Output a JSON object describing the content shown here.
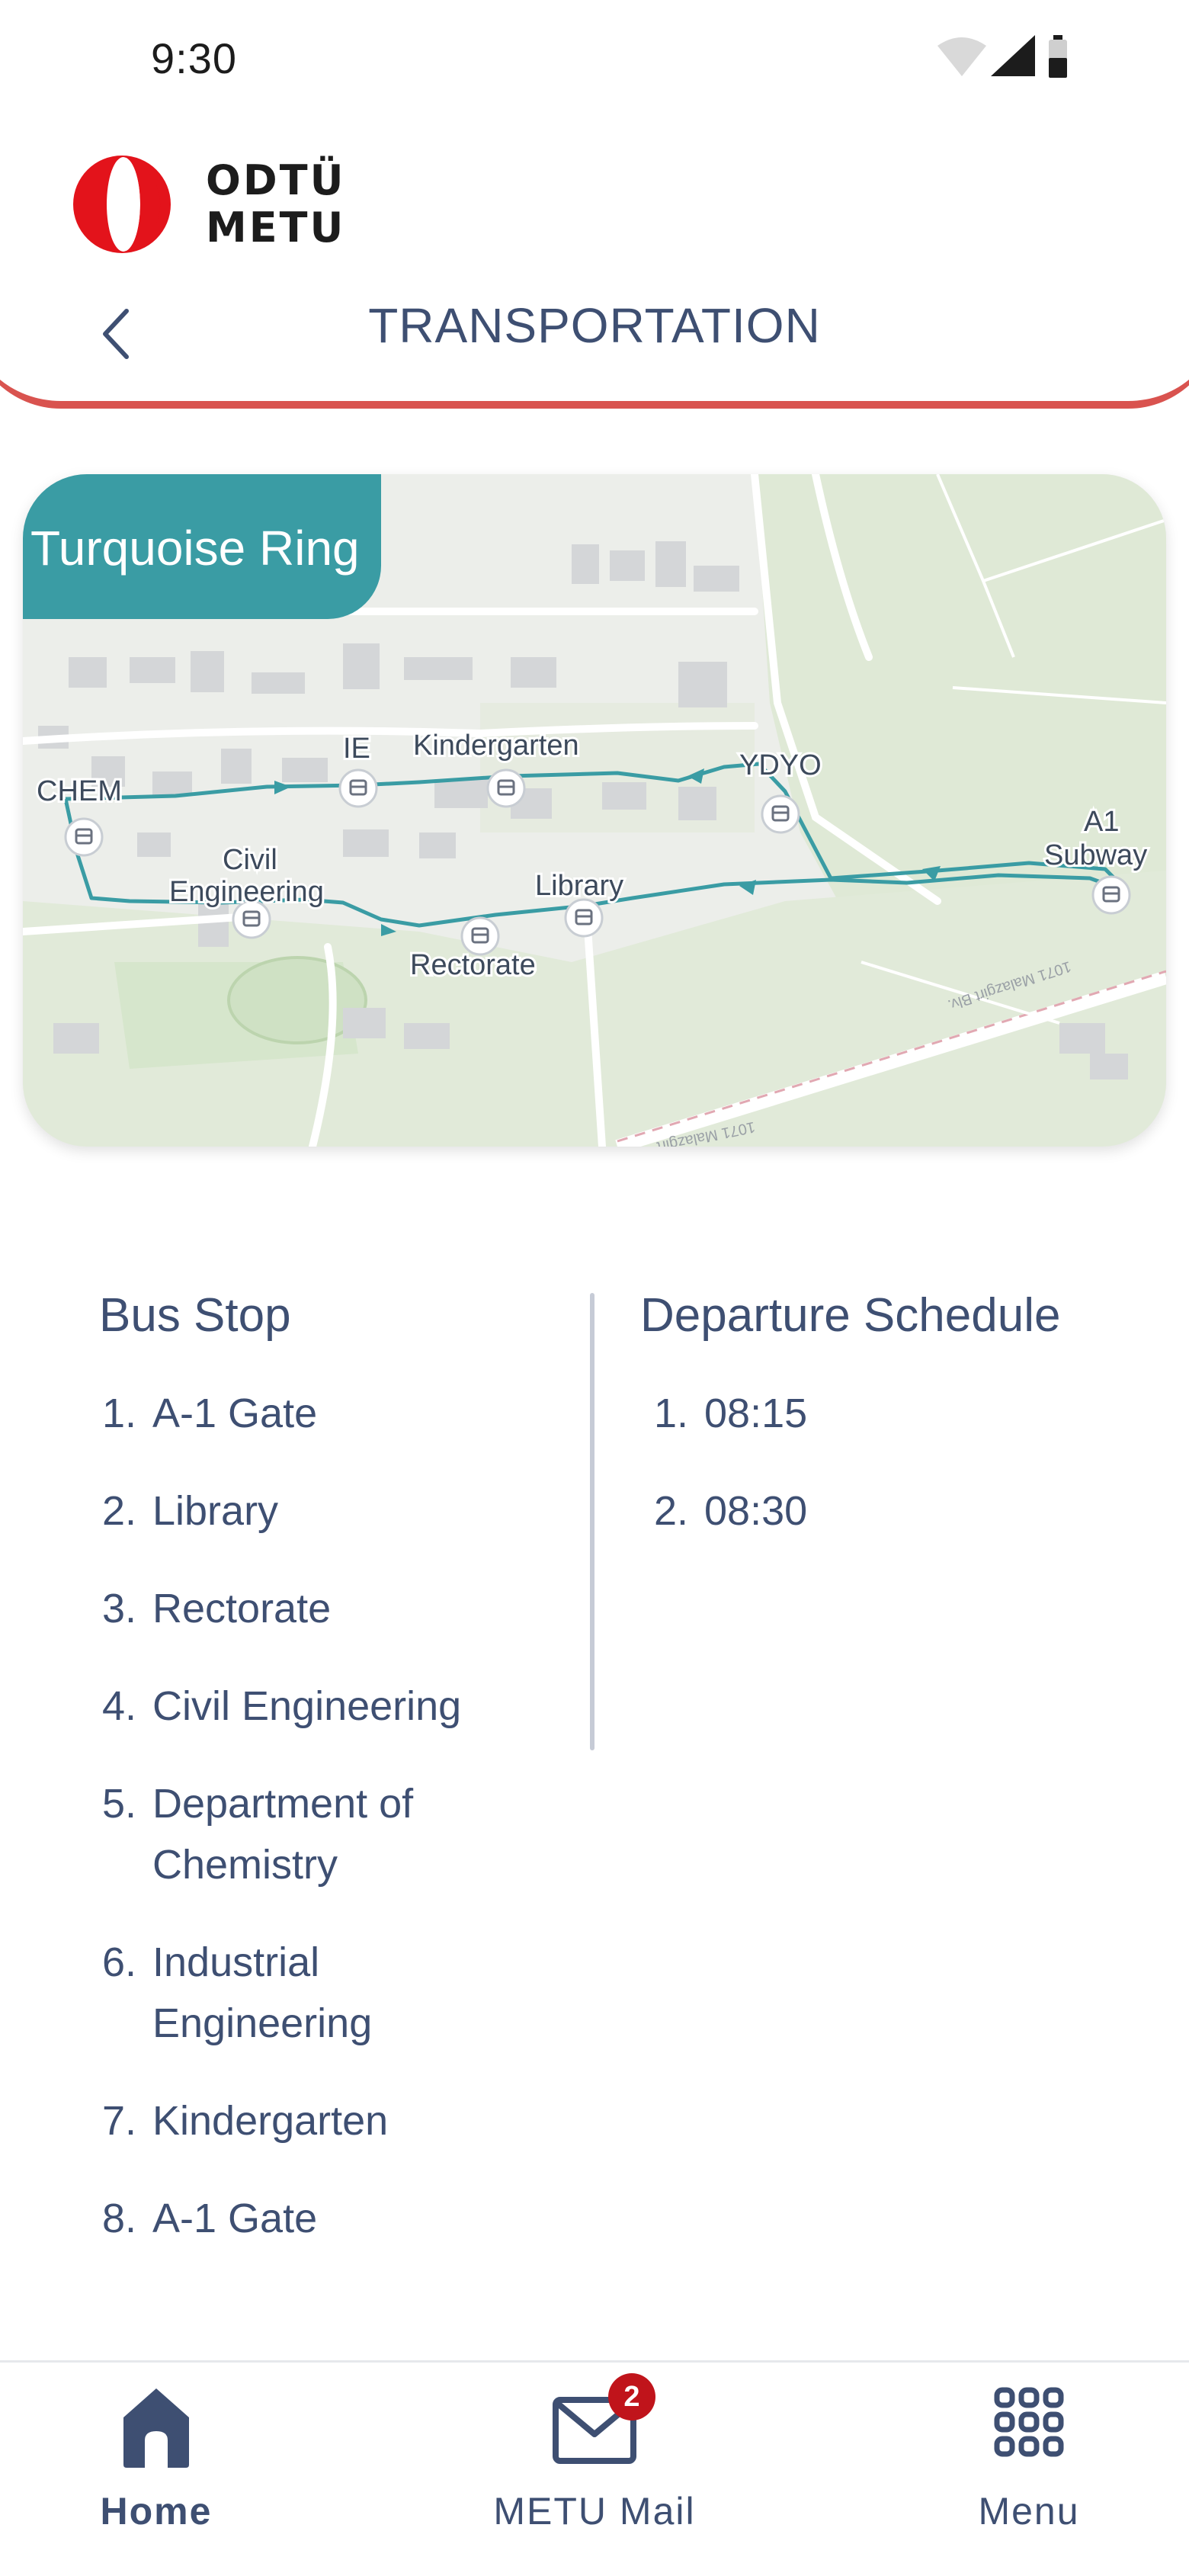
{
  "status_bar": {
    "time": "9:30"
  },
  "brand": {
    "line1": "ODTÜ",
    "line2": "METU",
    "colors": {
      "red": "#e3131b",
      "accent": "#d9534f"
    }
  },
  "header": {
    "title": "TRANSPORTATION",
    "back_icon": "chevron-left-icon"
  },
  "map": {
    "route_name": "Turquoise Ring",
    "route_color": "#3a9ca4",
    "stop_labels": [
      "CHEM",
      "IE",
      "Kindergarten",
      "YDYO",
      "Civil",
      "Engineering",
      "Library",
      "Rectorate",
      "A1",
      "Subway"
    ],
    "road_labels": [
      "1071 Malazgirt Blv.",
      "1071 Malazgirt"
    ]
  },
  "bus_stop": {
    "header": "Bus Stop",
    "items": [
      {
        "num": "1.",
        "line1": "A-1 Gate"
      },
      {
        "num": "2.",
        "line1": "Library"
      },
      {
        "num": "3.",
        "line1": "Rectorate"
      },
      {
        "num": "4.",
        "line1": "Civil Engineering"
      },
      {
        "num": "5.",
        "line1": "Department of",
        "line2": "Chemistry"
      },
      {
        "num": "6.",
        "line1": "Industrial",
        "line2": "Engineering"
      },
      {
        "num": "7.",
        "line1": "Kindergarten"
      },
      {
        "num": "8.",
        "line1": "A-1 Gate"
      }
    ]
  },
  "schedule": {
    "header": "Departure Schedule",
    "items": [
      {
        "num": "1.",
        "time": "08:15"
      },
      {
        "num": "2.",
        "time": "08:30"
      }
    ]
  },
  "nav": {
    "home": {
      "label": "Home",
      "icon": "home-icon"
    },
    "mail": {
      "label": "METU Mail",
      "icon": "mail-icon",
      "badge": "2"
    },
    "menu": {
      "label": "Menu",
      "icon": "grid-menu-icon"
    }
  }
}
